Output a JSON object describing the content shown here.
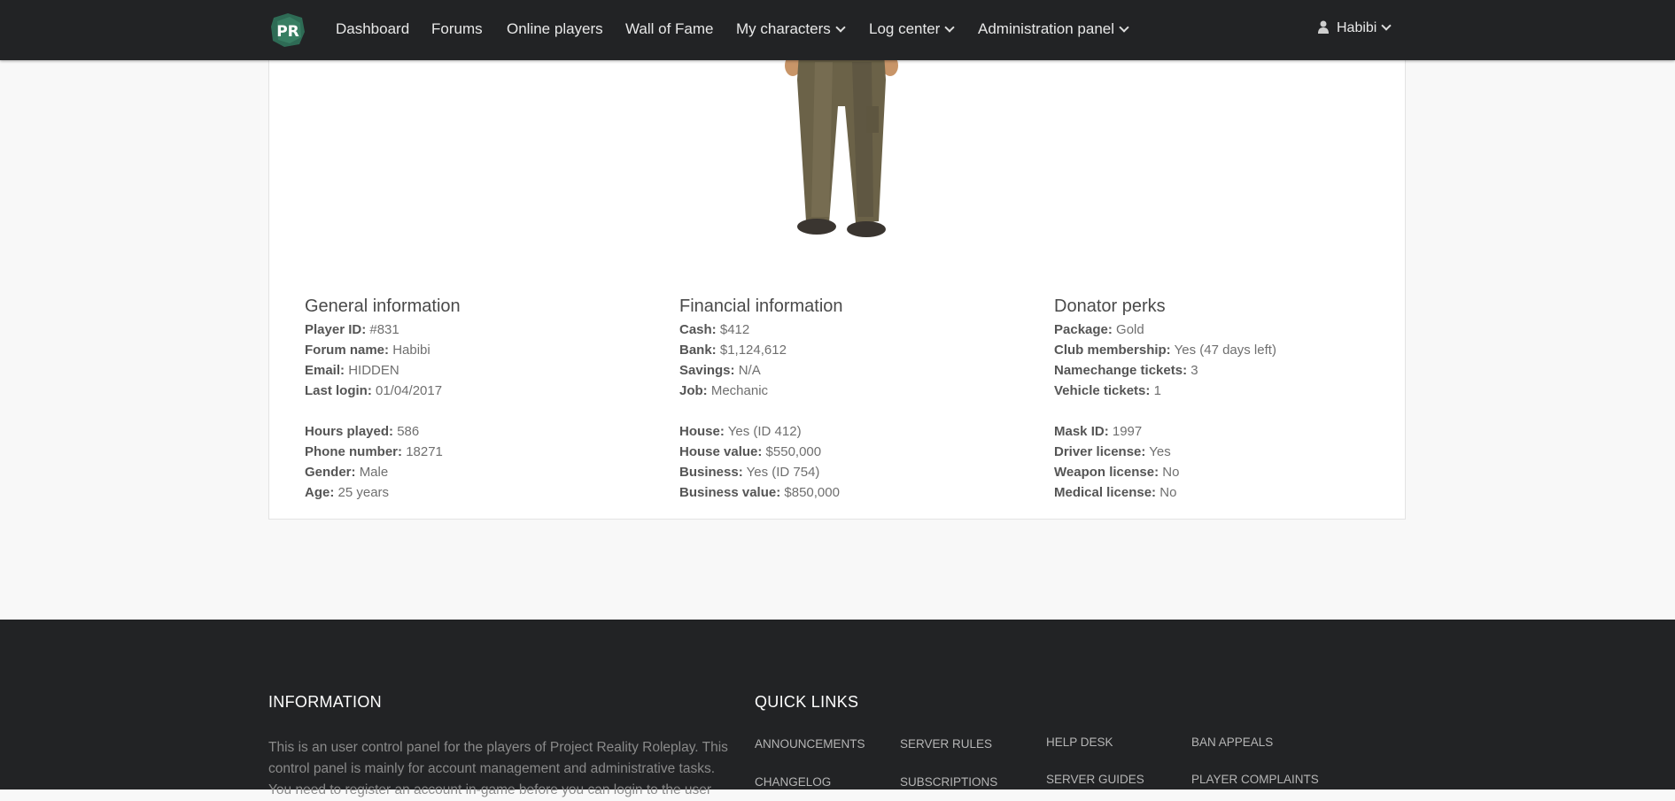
{
  "navbar": {
    "logo_text": "PR",
    "items": [
      {
        "label": "Dashboard"
      },
      {
        "label": "Forums"
      },
      {
        "label": "Online players"
      },
      {
        "label": "Wall of Fame"
      },
      {
        "label": "My characters"
      },
      {
        "label": "Log center"
      },
      {
        "label": "Administration panel"
      }
    ],
    "user": "Habibi"
  },
  "general": {
    "title": "General information",
    "player_id_label": "Player ID:",
    "player_id": "#831",
    "forum_name_label": "Forum name:",
    "forum_name": "Habibi",
    "email_label": "Email:",
    "email": "HIDDEN",
    "last_login_label": "Last login:",
    "last_login": "01/04/2017",
    "hours_label": "Hours played:",
    "hours": "586",
    "phone_label": "Phone number:",
    "phone": "18271",
    "gender_label": "Gender:",
    "gender": "Male",
    "age_label": "Age:",
    "age": "25 years"
  },
  "financial": {
    "title": "Financial information",
    "cash_label": "Cash:",
    "cash": "$412",
    "bank_label": "Bank:",
    "bank": "$1,124,612",
    "savings_label": "Savings:",
    "savings": "N/A",
    "job_label": "Job:",
    "job": "Mechanic",
    "house_label": "House:",
    "house": "Yes (ID 412)",
    "house_value_label": "House value:",
    "house_value": "$550,000",
    "business_label": "Business:",
    "business": "Yes (ID 754)",
    "business_value_label": "Business value:",
    "business_value": "$850,000"
  },
  "donator": {
    "title": "Donator perks",
    "package_label": "Package:",
    "package": "Gold",
    "club_label": "Club membership:",
    "club": "Yes (47 days left)",
    "namechange_label": "Namechange tickets:",
    "namechange": "3",
    "vehicle_label": "Vehicle tickets:",
    "vehicle": "1",
    "mask_label": "Mask ID:",
    "mask": "1997",
    "driver_label": "Driver license:",
    "driver": "Yes",
    "weapon_label": "Weapon license:",
    "weapon": "No",
    "medical_label": "Medical license:",
    "medical": "No"
  },
  "footer": {
    "info_title": "INFORMATION",
    "info_text": "This is an user control panel for the players of Project Reality Roleplay. This control panel is mainly for account management and administrative tasks. You need to register an account in-game before you can login to the user",
    "quick_title": "QUICK LINKS",
    "links": [
      "ANNOUNCEMENTS",
      "SERVER RULES",
      "HELP DESK",
      "BAN APPEALS",
      "CHANGELOG",
      "SUBSCRIPTIONS",
      "SERVER GUIDES",
      "PLAYER COMPLAINTS"
    ]
  },
  "colors": {
    "navbar_bg": "#222325",
    "footer_bg": "#222325",
    "logo_bg": "#2e6b55",
    "page_bg": "#f8f8f8"
  }
}
